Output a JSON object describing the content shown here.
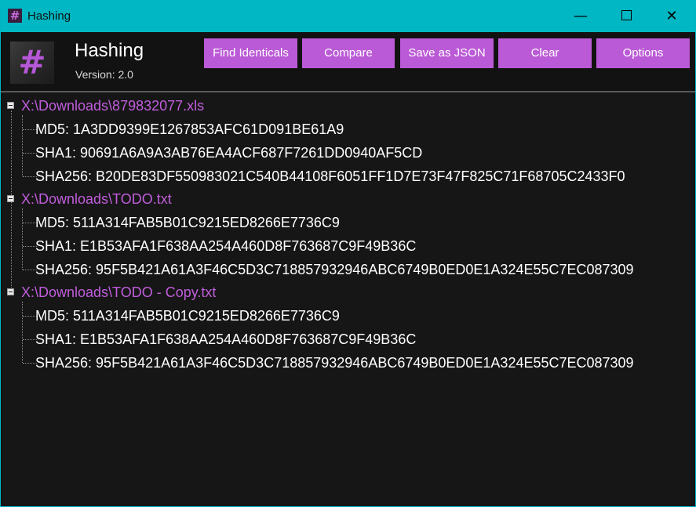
{
  "window": {
    "title": "Hashing",
    "icon": "hash-icon",
    "controls": {
      "minimize": "—",
      "close": "✕"
    }
  },
  "header": {
    "app_name": "Hashing",
    "version": "Version: 2.0",
    "logo_glyph": "#"
  },
  "toolbar": {
    "find_identicals": "Find Identicals",
    "compare": "Compare",
    "save_as_json": "Save as JSON",
    "clear": "Clear",
    "options": "Options"
  },
  "colors": {
    "titlebar": "#00b7c3",
    "accent": "#bb5ad6",
    "path_text": "#c15ddc",
    "background": "#161616"
  },
  "files": [
    {
      "path": "X:\\Downloads\\879832077.xls",
      "md5": "MD5: 1A3DD9399E1267853AFC61D091BE61A9",
      "sha1": "SHA1: 90691A6A9A3AB76EA4ACF687F7261DD0940AF5CD",
      "sha256": "SHA256: B20DE83DF550983021C540B44108F6051FF1D7E73F47F825C71F68705C2433F0"
    },
    {
      "path": "X:\\Downloads\\TODO.txt",
      "md5": "MD5: 511A314FAB5B01C9215ED8266E7736C9",
      "sha1": "SHA1: E1B53AFA1F638AA254A460D8F763687C9F49B36C",
      "sha256": "SHA256: 95F5B421A61A3F46C5D3C718857932946ABC6749B0ED0E1A324E55C7EC087309"
    },
    {
      "path": "X:\\Downloads\\TODO - Copy.txt",
      "md5": "MD5: 511A314FAB5B01C9215ED8266E7736C9",
      "sha1": "SHA1: E1B53AFA1F638AA254A460D8F763687C9F49B36C",
      "sha256": "SHA256: 95F5B421A61A3F46C5D3C718857932946ABC6749B0ED0E1A324E55C7EC087309"
    }
  ]
}
